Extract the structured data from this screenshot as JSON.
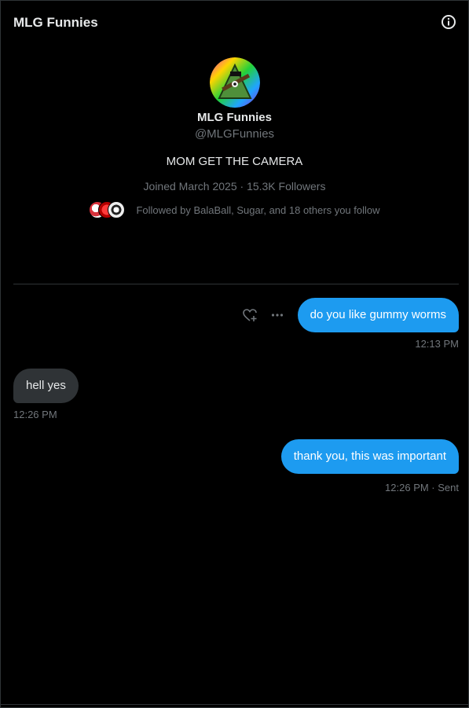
{
  "header": {
    "title": "MLG Funnies",
    "info_icon": "info-circle-icon"
  },
  "profile": {
    "display_name": "MLG Funnies",
    "handle": "@MLGFunnies",
    "bio": "MOM GET THE CAMERA",
    "joined": "Joined March 2025",
    "separator": "·",
    "followers": "15.3K Followers",
    "followed_by": "Followed by BalaBall, Sugar, and 18 others you follow"
  },
  "messages": [
    {
      "direction": "outgoing",
      "text": "do you like gummy worms",
      "time": "12:13 PM"
    },
    {
      "direction": "incoming",
      "text": "hell yes",
      "time": "12:26 PM"
    },
    {
      "direction": "outgoing",
      "text": "thank you, this was important",
      "time": "12:26 PM · Sent"
    }
  ],
  "actions": {
    "react_icon": "heart-plus-icon",
    "more_icon": "more-horizontal-icon"
  },
  "colors": {
    "accent": "#1d9bf0",
    "background": "#000000",
    "incoming_bubble": "#2f3336",
    "muted_text": "#71767b",
    "primary_text": "#e7e9ea"
  }
}
